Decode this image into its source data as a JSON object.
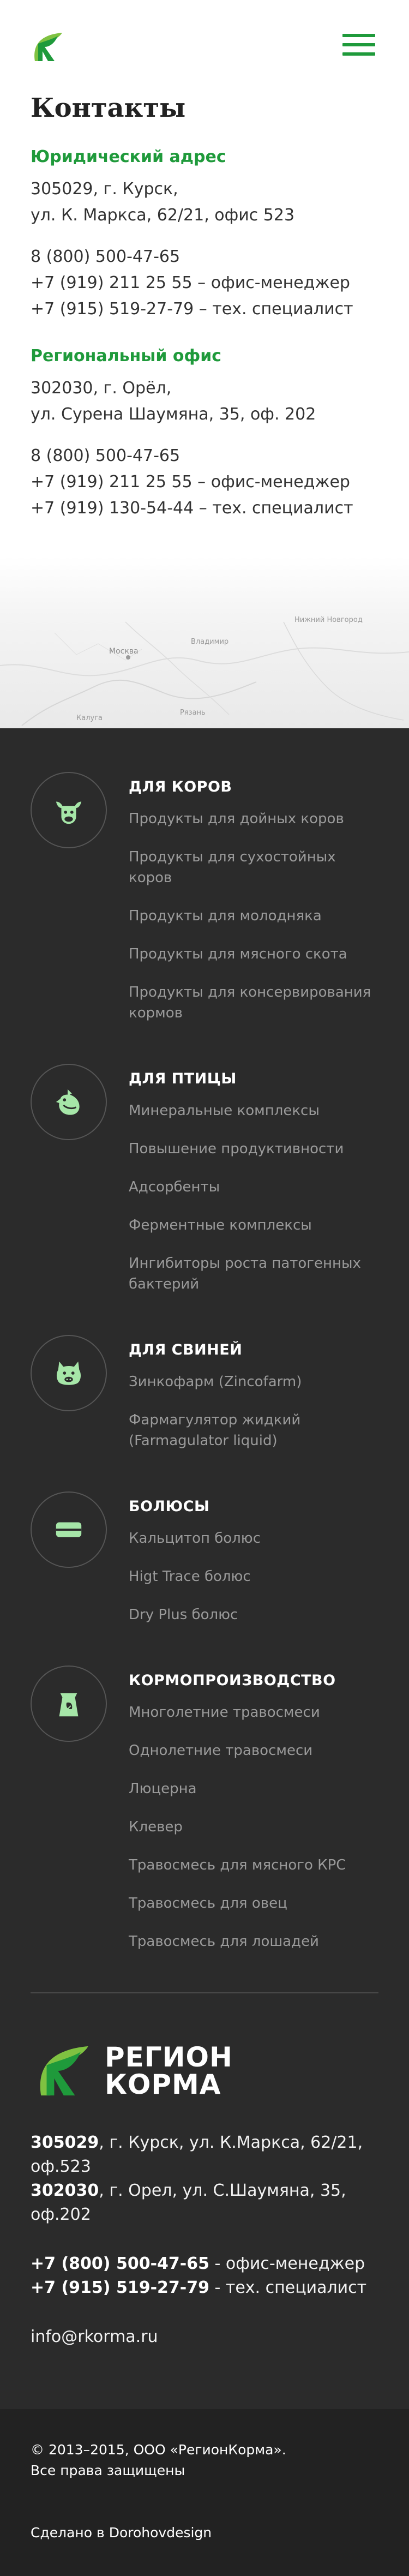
{
  "header": {
    "logo_icon": "rk-leaf-logo-icon",
    "menu_icon": "hamburger-menu-icon",
    "accent": "#1f9a3b"
  },
  "contacts": {
    "title": "Контакты",
    "legal": {
      "heading": "Юридический адрес",
      "address_line1": "305029, г. Курск,",
      "address_line2": "ул. К. Маркса, 62/21, офис 523",
      "phone1": "8 (800) 500-47-65",
      "phone2": "+7 (919) 211 25 55 – офис-менеджер",
      "phone3": "+7 (915) 519-27-79 – тех. специалист"
    },
    "regional": {
      "heading": "Региональный офис",
      "address_line1": "302030, г. Орёл,",
      "address_line2": "ул. Сурена Шаумяна, 35, оф. 202",
      "phone1": "8 (800) 500-47-65",
      "phone2": "+7 (919) 211 25 55 – офис-менеджер",
      "phone3": "+7 (919) 130-54-44 – тех. специалист"
    },
    "map_labels": {
      "city1": "Москва",
      "city2": "Владимир",
      "city3": "Нижний Новгород",
      "city4": "Калуга",
      "city5": "Рязань"
    }
  },
  "catalog": [
    {
      "icon": "cow-icon",
      "title": "Для коров",
      "items": [
        "Продукты для дойных коров",
        "Продукты для сухостойных коров",
        "Продукты для молодняка",
        "Продукты для мясного скота",
        "Продукты для консервирования кормов"
      ]
    },
    {
      "icon": "bird-icon",
      "title": "Для птицы",
      "items": [
        "Минеральные комплексы",
        "Повышение продуктивности",
        "Адсорбенты",
        "Ферментные комплексы",
        "Ингибиторы роста патогенных бактерий"
      ]
    },
    {
      "icon": "pig-icon",
      "title": "Для свиней",
      "items": [
        "Зинкофарм (Zincofarm)",
        "Фармагулятор жидкий (Farmagulator liquid)"
      ]
    },
    {
      "icon": "bolus-icon",
      "title": "Болюсы",
      "items": [
        "Кальцитоп болюс",
        "Higt Trace болюс",
        "Dry Plus болюс"
      ]
    },
    {
      "icon": "feed-bag-icon",
      "title": "Кормопроизводство",
      "items": [
        "Многолетние травосмеси",
        "Однолетние травосмеси",
        "Люцерна",
        "Клевер",
        "Травосмесь для мясного КРС",
        "Травосмесь для овец",
        "Травосмесь для лошадей"
      ]
    }
  ],
  "footer": {
    "brand_line1": "Регион",
    "brand_line2": "Корма",
    "addr1_bold": "305029",
    "addr1_rest": ", г. Курск, ул. К.Маркса, 62/21, оф.523",
    "addr2_bold": "302030",
    "addr2_rest": ", г. Орел, ул. С.Шаумяна, 35, оф.202",
    "phone1_bold": "+7 (800) 500-47-65",
    "phone1_rest": " - офис-менеджер",
    "phone2_bold": "+7 (915) 519-27-79",
    "phone2_rest": " - тех. специалист",
    "email": "info@rkorma.ru",
    "copyright1": "© 2013–2015, ООО «РегионКорма».",
    "copyright2": "Все права защищены",
    "made_by": "Сделано в Dorohovdesign"
  }
}
